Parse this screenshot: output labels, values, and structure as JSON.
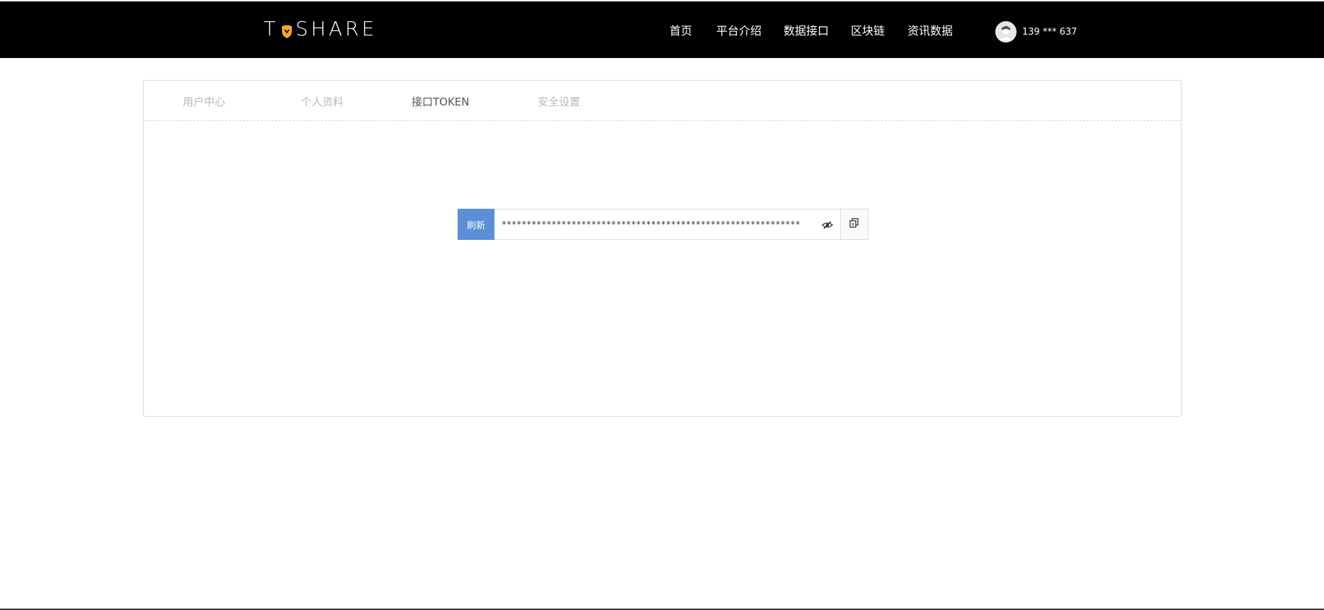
{
  "header": {
    "logo": {
      "pre": "T",
      "post": "SHARE"
    },
    "nav": [
      {
        "label": "首页"
      },
      {
        "label": "平台介绍"
      },
      {
        "label": "数据接口"
      },
      {
        "label": "区块链"
      },
      {
        "label": "资讯数据"
      }
    ],
    "user": {
      "phone": "139 *** 637",
      "avatar_icon": "avatar-icon"
    }
  },
  "tabs": [
    {
      "label": "用户中心",
      "active": false
    },
    {
      "label": "个人资料",
      "active": false
    },
    {
      "label": "接口TOKEN",
      "active": true
    },
    {
      "label": "安全设置",
      "active": false
    }
  ],
  "token": {
    "refresh_label": "刷新",
    "masked_value": "************************************************************",
    "eye_icon": "eye-slash-icon",
    "copy_icon": "copy-icon"
  },
  "colors": {
    "header_bg": "#000000",
    "accent_blue": "#5b8fd6",
    "logo_orange": "#f5a623"
  }
}
